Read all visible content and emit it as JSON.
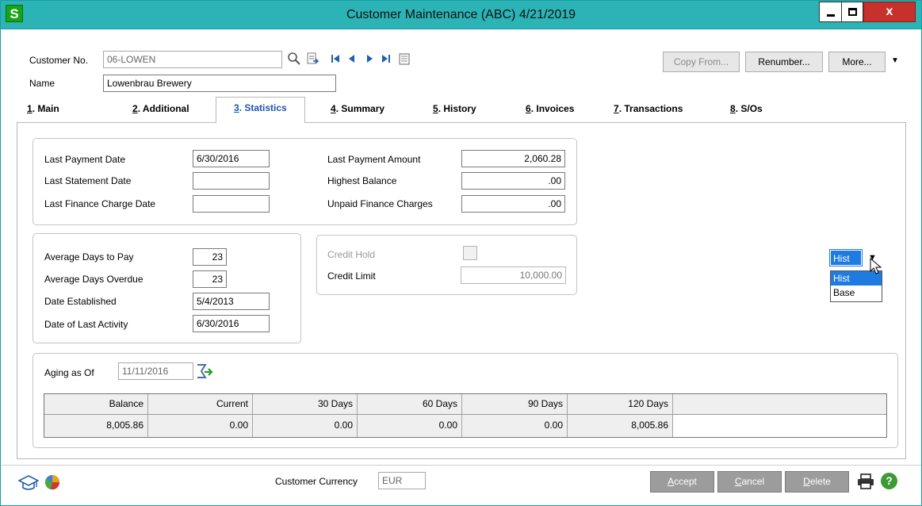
{
  "window": {
    "app_icon": "S",
    "title": "Customer Maintenance (ABC) 4/21/2019",
    "minimize_icon": "minimize-icon",
    "maximize_icon": "maximize-icon",
    "close_label": "x"
  },
  "header": {
    "customer_no_label": "Customer No.",
    "customer_no_value": "06-LOWEN",
    "name_label": "Name",
    "name_value": "Lowenbrau Brewery",
    "icons": [
      "search-icon",
      "lookup-icon",
      "first-record-icon",
      "previous-record-icon",
      "next-record-icon",
      "last-record-icon",
      "memo-icon"
    ],
    "copy_from_label": "Copy From...",
    "renumber_label": "Renumber...",
    "more_label": "More...",
    "more_arrow": "▼"
  },
  "tabs": [
    {
      "num": "1",
      "label": ". Main"
    },
    {
      "num": "2",
      "label": ". Additional"
    },
    {
      "num": "3",
      "label": ". Statistics"
    },
    {
      "num": "4",
      "label": ". Summary"
    },
    {
      "num": "5",
      "label": ". History"
    },
    {
      "num": "6",
      "label": ". Invoices"
    },
    {
      "num": "7",
      "label": ". Transactions"
    },
    {
      "num": "8",
      "label": ". S/Os"
    }
  ],
  "payment": {
    "last_payment_date_label": "Last Payment Date",
    "last_payment_date_value": "6/30/2016",
    "last_statement_date_label": "Last Statement Date",
    "last_statement_date_value": "",
    "last_finance_charge_date_label": "Last Finance Charge Date",
    "last_finance_charge_date_value": "",
    "last_payment_amount_label": "Last Payment Amount",
    "last_payment_amount_value": "2,060.28",
    "highest_balance_label": "Highest Balance",
    "highest_balance_value": ".00",
    "unpaid_finance_charges_label": "Unpaid Finance Charges",
    "unpaid_finance_charges_value": ".00"
  },
  "days": {
    "avg_days_to_pay_label": "Average Days to Pay",
    "avg_days_to_pay_value": "23",
    "avg_days_overdue_label": "Average Days Overdue",
    "avg_days_overdue_value": "23",
    "date_established_label": "Date Established",
    "date_established_value": "5/4/2013",
    "date_last_activity_label": "Date of Last Activity",
    "date_last_activity_value": "6/30/2016"
  },
  "credit": {
    "credit_hold_label": "Credit Hold",
    "credit_limit_label": "Credit Limit",
    "credit_limit_value": "10,000.00"
  },
  "hist_dropdown": {
    "selected": "Hist",
    "arrow": "▼",
    "options": [
      "Hist",
      "Base"
    ]
  },
  "aging": {
    "label": "Aging as Of",
    "date_value": "11/11/2016",
    "columns": [
      "Balance",
      "Current",
      "30 Days",
      "60 Days",
      "90 Days",
      "120 Days"
    ],
    "values": [
      "8,005.86",
      "0.00",
      "0.00",
      "0.00",
      "0.00",
      "8,005.86"
    ]
  },
  "footer": {
    "currency_label": "Customer Currency",
    "currency_value": "EUR",
    "accept_u": "A",
    "accept_rest": "ccept",
    "cancel_u": "C",
    "cancel_rest": "ancel",
    "delete_u": "D",
    "delete_rest": "elete",
    "help_label": "?"
  },
  "colors": {
    "titlebar": "#2bb3b6",
    "active_tab": "#1f55b0",
    "close_button": "#c7312b",
    "selection": "#1f7be0"
  }
}
